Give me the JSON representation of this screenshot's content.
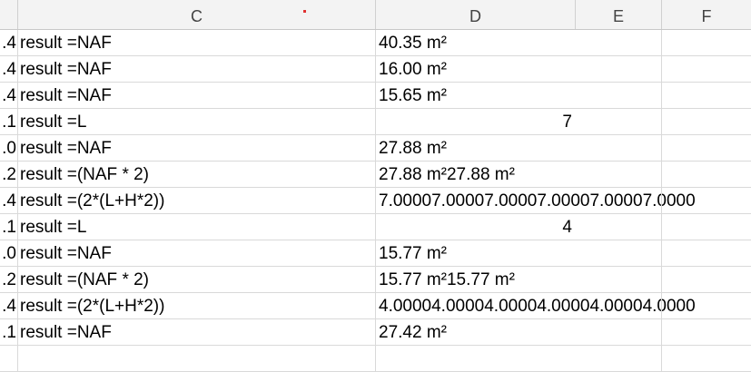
{
  "columns": [
    "C",
    "D",
    "E",
    "F"
  ],
  "rows": [
    {
      "b": ".4",
      "c": "result =NAF",
      "d": "40.35 m²",
      "d_align": "left"
    },
    {
      "b": ".4",
      "c": "result =NAF",
      "d": "16.00 m²",
      "d_align": "left"
    },
    {
      "b": ".4",
      "c": "result =NAF",
      "d": "15.65 m²",
      "d_align": "left"
    },
    {
      "b": ".1",
      "c": "result =L",
      "d": "7",
      "d_align": "right"
    },
    {
      "b": ".0",
      "c": "result =NAF",
      "d": "27.88 m²",
      "d_align": "left"
    },
    {
      "b": ".2",
      "c": "result =(NAF * 2)",
      "d": "27.88 m²27.88 m²",
      "d_align": "left"
    },
    {
      "b": ".4",
      "c": "result =(2*(L+H*2))",
      "d": "7.00007.00007.00007.00007.00007.0000",
      "d_align": "left"
    },
    {
      "b": ".1",
      "c": "result =L",
      "d": "4",
      "d_align": "right"
    },
    {
      "b": ".0",
      "c": "result =NAF",
      "d": "15.77 m²",
      "d_align": "left"
    },
    {
      "b": ".2",
      "c": "result =(NAF * 2)",
      "d": "15.77 m²15.77 m²",
      "d_align": "left"
    },
    {
      "b": ".4",
      "c": "result =(2*(L+H*2))",
      "d": "4.00004.00004.00004.00004.00004.0000",
      "d_align": "left"
    },
    {
      "b": ".1",
      "c": "result =NAF",
      "d": "27.42 m²",
      "d_align": "left"
    },
    {
      "b": "",
      "c": "",
      "d": "",
      "d_align": "left"
    }
  ],
  "colors": {
    "header_bg": "#f3f3f3",
    "grid_line": "#d9d9d9"
  }
}
